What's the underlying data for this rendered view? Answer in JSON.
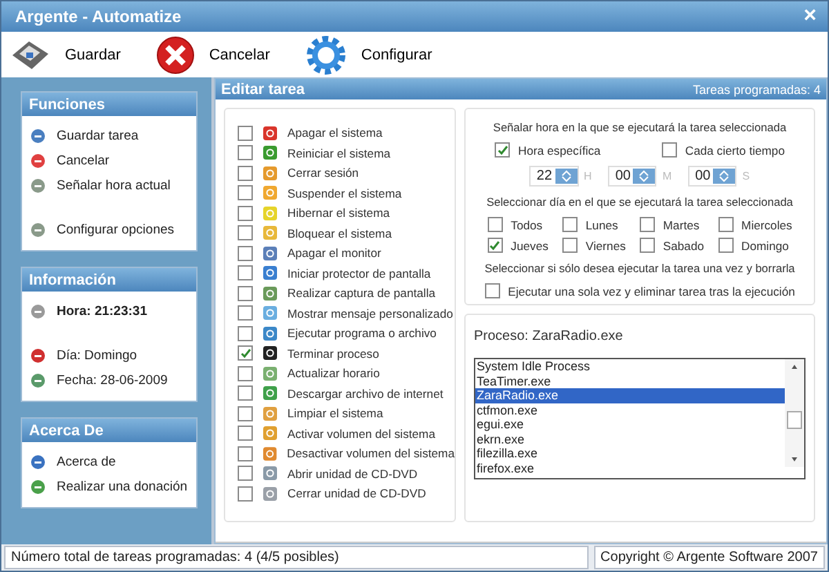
{
  "window": {
    "title": "Argente - Automatize",
    "close": "×"
  },
  "toolbar": [
    "Guardar",
    "Cancelar",
    "Configurar"
  ],
  "sidebar": [
    {
      "title": "Funciones",
      "groups": [
        [
          {
            "label": "Guardar tarea"
          },
          {
            "label": "Cancelar"
          },
          {
            "label": "Señalar hora actual"
          }
        ],
        [
          {
            "label": "Configurar opciones"
          }
        ]
      ]
    },
    {
      "title": "Información",
      "groups": [
        [
          {
            "label": "Hora: 21:23:31",
            "bold": true
          }
        ],
        [
          {
            "label": "Día: Domingo",
            "bold": false
          },
          {
            "label": "Fecha: 28-06-2009",
            "bold": false
          }
        ]
      ]
    },
    {
      "title": "Acerca De",
      "groups": [
        [
          {
            "label": "Acerca de"
          },
          {
            "label": "Realizar una donación"
          }
        ]
      ]
    }
  ],
  "editor": {
    "title": "Editar tarea",
    "count": "Tareas programadas: 4",
    "actions": [
      {
        "label": "Apagar el sistema",
        "checked": false
      },
      {
        "label": "Reiniciar el sistema",
        "checked": false
      },
      {
        "label": "Cerrar sesión",
        "checked": false
      },
      {
        "label": "Suspender el sistema",
        "checked": false
      },
      {
        "label": "Hibernar el sistema",
        "checked": false
      },
      {
        "label": "Bloquear el sistema",
        "checked": false
      },
      {
        "label": "Apagar el monitor",
        "checked": false
      },
      {
        "label": "Iniciar protector de pantalla",
        "checked": false
      },
      {
        "label": "Realizar captura de pantalla",
        "checked": false
      },
      {
        "label": "Mostrar mensaje personalizado",
        "checked": false
      },
      {
        "label": "Ejecutar programa o archivo",
        "checked": false
      },
      {
        "label": "Terminar proceso",
        "checked": true
      },
      {
        "label": "Actualizar horario",
        "checked": false
      },
      {
        "label": "Descargar archivo de internet",
        "checked": false
      },
      {
        "label": "Limpiar el sistema",
        "checked": false
      },
      {
        "label": "Activar volumen del sistema",
        "checked": false
      },
      {
        "label": "Desactivar volumen del sistema",
        "checked": false
      },
      {
        "label": "Abrir unidad de CD-DVD",
        "checked": false
      },
      {
        "label": "Cerrar unidad de CD-DVD",
        "checked": false
      }
    ],
    "time_heading": "Señalar hora en la que se ejecutará la tarea seleccionada",
    "time_modes": [
      {
        "label": "Hora específica",
        "checked": true
      },
      {
        "label": "Cada cierto tiempo",
        "checked": false
      }
    ],
    "time": [
      {
        "value": "22",
        "unit": "H"
      },
      {
        "value": "00",
        "unit": "M"
      },
      {
        "value": "00",
        "unit": "S"
      }
    ],
    "day_heading": "Seleccionar día en el que se ejecutará la tarea seleccionada",
    "days": [
      {
        "label": "Todos",
        "checked": false
      },
      {
        "label": "Lunes",
        "checked": false
      },
      {
        "label": "Martes",
        "checked": false
      },
      {
        "label": "Miercoles",
        "checked": false
      },
      {
        "label": "Jueves",
        "checked": true
      },
      {
        "label": "Viernes",
        "checked": false
      },
      {
        "label": "Sabado",
        "checked": false
      },
      {
        "label": "Domingo",
        "checked": false
      }
    ],
    "once_heading": "Seleccionar si sólo desea ejecutar la tarea una vez y borrarla",
    "once": {
      "label": "Ejecutar una sola vez y eliminar tarea tras la ejecución",
      "checked": false
    },
    "process_label": "Proceso: ZaraRadio.exe",
    "processes": [
      {
        "name": "System Idle Process",
        "selected": false
      },
      {
        "name": "TeaTimer.exe",
        "selected": false
      },
      {
        "name": "ZaraRadio.exe",
        "selected": true
      },
      {
        "name": "ctfmon.exe",
        "selected": false
      },
      {
        "name": "egui.exe",
        "selected": false
      },
      {
        "name": "ekrn.exe",
        "selected": false
      },
      {
        "name": "filezilla.exe",
        "selected": false
      },
      {
        "name": "firefox.exe",
        "selected": false
      }
    ]
  },
  "status_bar": [
    "Número total de tareas programadas: 4 (4/5 posibles)",
    "Copyright © Argente Software 2007"
  ]
}
